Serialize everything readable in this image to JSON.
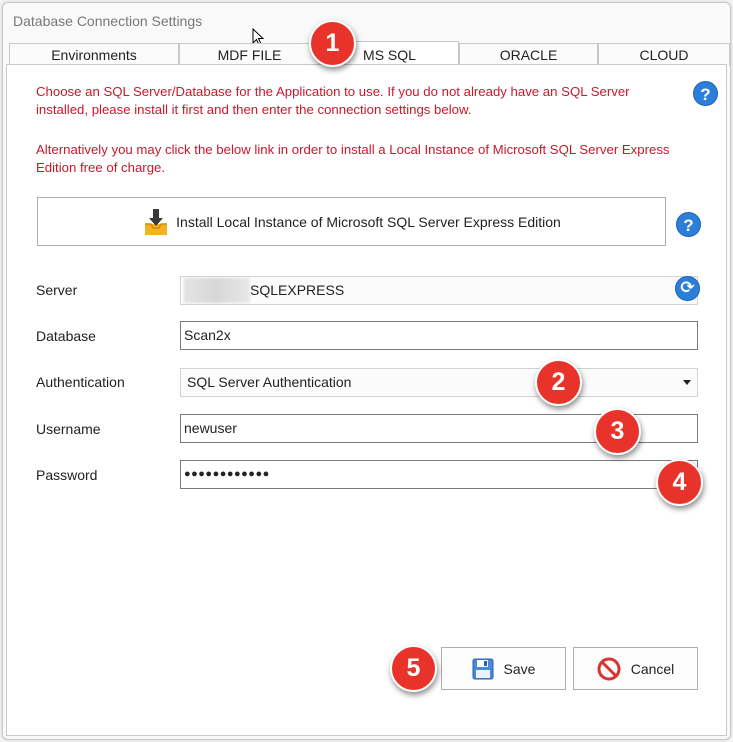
{
  "window": {
    "title": "Database Connection Settings"
  },
  "tabs": [
    {
      "label": "Environments"
    },
    {
      "label": "MDF FILE"
    },
    {
      "label": "MS SQL"
    },
    {
      "label": "ORACLE"
    },
    {
      "label": "CLOUD"
    }
  ],
  "info": {
    "line1": "Choose an SQL Server/Database for the Application to use. If you do not already have an SQL Server installed, please install it first and then enter the connection settings below.",
    "line2": "Alternatively you may click the below link in order to install a Local Instance of Microsoft SQL Server Express Edition free of charge."
  },
  "install_button": {
    "label": "Install Local Instance of Microsoft SQL Server Express Edition"
  },
  "help": {
    "symbol": "?"
  },
  "form": {
    "server": {
      "label": "Server",
      "value": "SQLEXPRESS"
    },
    "database": {
      "label": "Database",
      "value": "Scan2x"
    },
    "authentication": {
      "label": "Authentication",
      "value": "SQL Server Authentication"
    },
    "username": {
      "label": "Username",
      "value": "newuser"
    },
    "password": {
      "label": "Password",
      "value": "●●●●●●●●●●●●"
    }
  },
  "buttons": {
    "save": "Save",
    "cancel": "Cancel"
  },
  "badges": [
    "1",
    "2",
    "3",
    "4",
    "5"
  ],
  "colors": {
    "info_text": "#c8192b",
    "accent_blue": "#2b7fd9",
    "badge_red": "#e8332b"
  }
}
